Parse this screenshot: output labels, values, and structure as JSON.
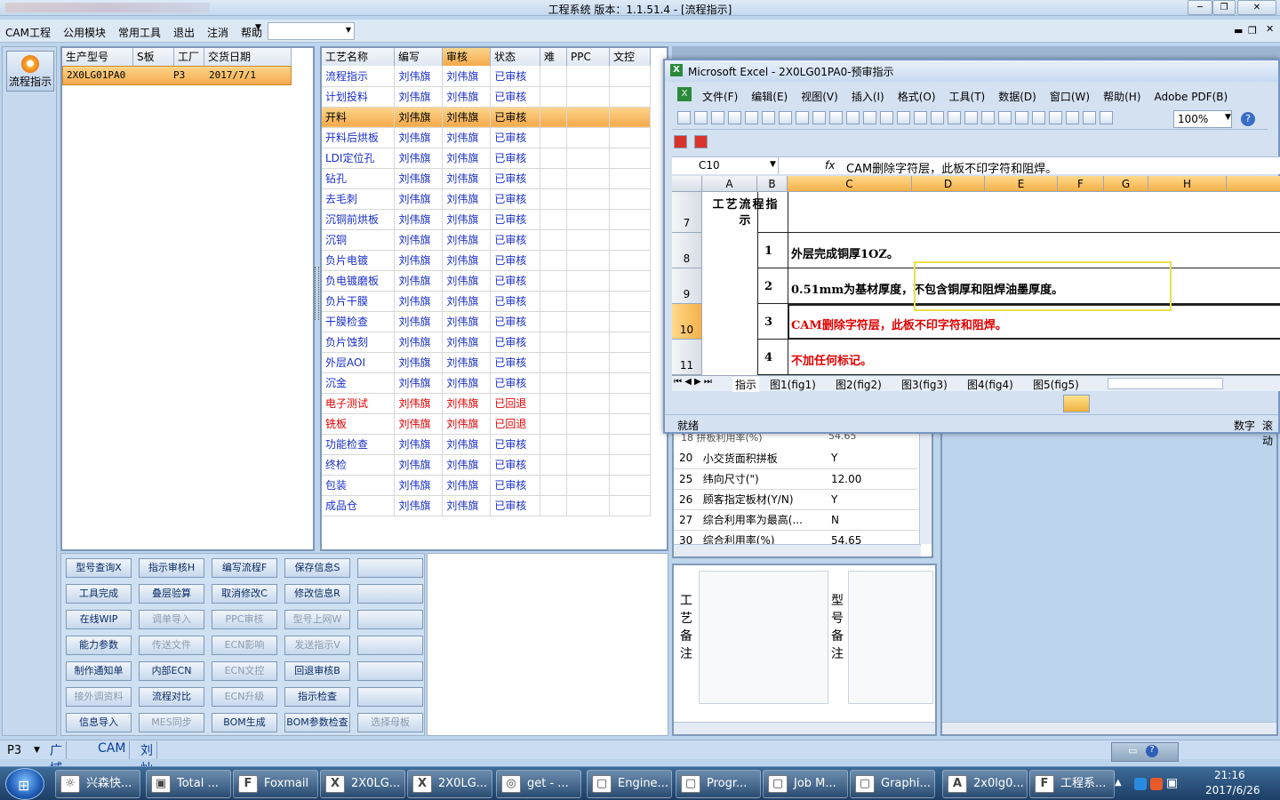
{
  "app": {
    "title": "工程系统  版本：1.1.51.4 - [流程指示]"
  },
  "menu": [
    "CAM工程",
    "公用模块",
    "常用工具",
    "退出",
    "注消",
    "帮助"
  ],
  "nav": {
    "button": "流程指示"
  },
  "orders": {
    "headers": [
      "生产型号",
      "S板",
      "工厂",
      "交货日期"
    ],
    "rows": [
      {
        "model": "2X0LG01PA0",
        "s": "",
        "factory": "P3",
        "date": "2017/7/1"
      }
    ]
  },
  "process": {
    "headers": [
      "工艺名称",
      "编写",
      "审核",
      "状态",
      "难",
      "PPC",
      "文控"
    ],
    "rows": [
      {
        "name": "流程指示",
        "writer": "刘伟旗",
        "reviewer": "刘伟旗",
        "status": "已审核",
        "color": "blue"
      },
      {
        "name": "计划投料",
        "writer": "刘伟旗",
        "reviewer": "刘伟旗",
        "status": "已审核",
        "color": "blue"
      },
      {
        "name": "开料",
        "writer": "刘伟旗",
        "reviewer": "刘伟旗",
        "status": "已审核",
        "color": "blue"
      },
      {
        "name": "开料后烘板",
        "writer": "刘伟旗",
        "reviewer": "刘伟旗",
        "status": "已审核",
        "color": "blue"
      },
      {
        "name": "LDI定位孔",
        "writer": "刘伟旗",
        "reviewer": "刘伟旗",
        "status": "已审核",
        "color": "blue"
      },
      {
        "name": "钻孔",
        "writer": "刘伟旗",
        "reviewer": "刘伟旗",
        "status": "已审核",
        "color": "blue"
      },
      {
        "name": "去毛刺",
        "writer": "刘伟旗",
        "reviewer": "刘伟旗",
        "status": "已审核",
        "color": "blue"
      },
      {
        "name": "沉铜前烘板",
        "writer": "刘伟旗",
        "reviewer": "刘伟旗",
        "status": "已审核",
        "color": "blue"
      },
      {
        "name": "沉铜",
        "writer": "刘伟旗",
        "reviewer": "刘伟旗",
        "status": "已审核",
        "color": "blue"
      },
      {
        "name": "负片电镀",
        "writer": "刘伟旗",
        "reviewer": "刘伟旗",
        "status": "已审核",
        "color": "blue"
      },
      {
        "name": "负电镀磨板",
        "writer": "刘伟旗",
        "reviewer": "刘伟旗",
        "status": "已审核",
        "color": "blue"
      },
      {
        "name": "负片干膜",
        "writer": "刘伟旗",
        "reviewer": "刘伟旗",
        "status": "已审核",
        "color": "blue"
      },
      {
        "name": "干膜检查",
        "writer": "刘伟旗",
        "reviewer": "刘伟旗",
        "status": "已审核",
        "color": "blue"
      },
      {
        "name": "负片蚀刻",
        "writer": "刘伟旗",
        "reviewer": "刘伟旗",
        "status": "已审核",
        "color": "blue"
      },
      {
        "name": "外层AOI",
        "writer": "刘伟旗",
        "reviewer": "刘伟旗",
        "status": "已审核",
        "color": "blue"
      },
      {
        "name": "沉金",
        "writer": "刘伟旗",
        "reviewer": "刘伟旗",
        "status": "已审核",
        "color": "blue"
      },
      {
        "name": "电子测试",
        "writer": "刘伟旗",
        "reviewer": "刘伟旗",
        "status": "已回退",
        "color": "red"
      },
      {
        "name": "铣板",
        "writer": "刘伟旗",
        "reviewer": "刘伟旗",
        "status": "已回退",
        "color": "red"
      },
      {
        "name": "功能检查",
        "writer": "刘伟旗",
        "reviewer": "刘伟旗",
        "status": "已审核",
        "color": "blue"
      },
      {
        "name": "终检",
        "writer": "刘伟旗",
        "reviewer": "刘伟旗",
        "status": "已审核",
        "color": "blue"
      },
      {
        "name": "包装",
        "writer": "刘伟旗",
        "reviewer": "刘伟旗",
        "status": "已审核",
        "color": "blue"
      },
      {
        "name": "成品仓",
        "writer": "刘伟旗",
        "reviewer": "刘伟旗",
        "status": "已审核",
        "color": "blue"
      }
    ]
  },
  "buttons": [
    {
      "label": "型号查询X",
      "enabled": true
    },
    {
      "label": "指示审核H",
      "enabled": true
    },
    {
      "label": "编写流程F",
      "enabled": true
    },
    {
      "label": "保存信息S",
      "enabled": true
    },
    {
      "label": "",
      "enabled": true
    },
    {
      "label": "工具完成",
      "enabled": true
    },
    {
      "label": "叠层验算",
      "enabled": true
    },
    {
      "label": "取消修改C",
      "enabled": true
    },
    {
      "label": "修改信息R",
      "enabled": true
    },
    {
      "label": "",
      "enabled": true
    },
    {
      "label": "在线WIP",
      "enabled": true
    },
    {
      "label": "调单导入",
      "enabled": false
    },
    {
      "label": "PPC审核",
      "enabled": false
    },
    {
      "label": "型号上网W",
      "enabled": false
    },
    {
      "label": "",
      "enabled": true
    },
    {
      "label": "能力参数",
      "enabled": true
    },
    {
      "label": "传送文件",
      "enabled": false
    },
    {
      "label": "ECN影响",
      "enabled": false
    },
    {
      "label": "发送指示V",
      "enabled": false
    },
    {
      "label": "",
      "enabled": true
    },
    {
      "label": "制作通知单",
      "enabled": true
    },
    {
      "label": "内部ECN",
      "enabled": true
    },
    {
      "label": "ECN文控",
      "enabled": false
    },
    {
      "label": "回退审核B",
      "enabled": true
    },
    {
      "label": "",
      "enabled": true
    },
    {
      "label": "接外调资料",
      "enabled": false
    },
    {
      "label": "流程对比",
      "enabled": true
    },
    {
      "label": "ECN升级",
      "enabled": false
    },
    {
      "label": "指示检查",
      "enabled": true
    },
    {
      "label": "",
      "enabled": true
    },
    {
      "label": "信息导入",
      "enabled": true
    },
    {
      "label": "MES同步",
      "enabled": false
    },
    {
      "label": "BOM生成",
      "enabled": true
    },
    {
      "label": "BOM参数检查",
      "enabled": true
    },
    {
      "label": "选择母板",
      "enabled": false
    }
  ],
  "props": {
    "rows": [
      {
        "num": "20",
        "name": "小交货面积拼板",
        "value": "Y"
      },
      {
        "num": "25",
        "name": "纬向尺寸(\")",
        "value": "12.00"
      },
      {
        "num": "26",
        "name": "顾客指定板材(Y/N)",
        "value": "Y"
      },
      {
        "num": "27",
        "name": "综合利用率为最高(...",
        "value": "N"
      },
      {
        "num": "30",
        "name": "综合利用率(%)",
        "value": "54.65"
      }
    ],
    "partial_top": "拼板利用率(%)",
    "partial_top_value": "54.65"
  },
  "notes": {
    "process_label": "工艺备注",
    "model_label": "型号备注"
  },
  "excel": {
    "title": "Microsoft Excel - 2X0LG01PA0-预审指示",
    "menu": [
      "文件(F)",
      "编辑(E)",
      "视图(V)",
      "插入(I)",
      "格式(O)",
      "工具(T)",
      "数据(D)",
      "窗口(W)",
      "帮助(H)",
      "Adobe PDF(B)"
    ],
    "zoom": "100%",
    "namebox": "C10",
    "formula": "CAM删除字符层，此板不印字符和阻焊。",
    "columns": [
      "A",
      "B",
      "C",
      "D",
      "E",
      "F",
      "G",
      "H"
    ],
    "header_cell": "工艺流程指示",
    "rows": [
      {
        "row": "7",
        "num": "",
        "text": "",
        "color": "black"
      },
      {
        "row": "8",
        "num": "1",
        "text": "外层完成铜厚1OZ。",
        "color": "black"
      },
      {
        "row": "9",
        "num": "2",
        "text": "0.51mm为基材厚度，不包含铜厚和阻焊油墨厚度。",
        "color": "black"
      },
      {
        "row": "10",
        "num": "3",
        "text": "CAM删除字符层，此板不印字符和阻焊。",
        "color": "red"
      },
      {
        "row": "11",
        "num": "4",
        "text": "不加任何标记。",
        "color": "red"
      }
    ],
    "tabs": [
      "指示",
      "图1(fig1)",
      "图2(fig2)",
      "图3(fig3)",
      "图4(fig4)",
      "图5(fig5)"
    ],
    "status_left": "就绪",
    "status_right": "数字",
    "status_far": "滚动"
  },
  "status": {
    "factory": "P3",
    "items": [
      "广域网",
      "CAM",
      "刘灿"
    ]
  },
  "taskbar": {
    "items": [
      "兴森快...",
      "Total ...",
      "Foxmail",
      "2X0LG...",
      "2X0LG...",
      "get - ...",
      "Engine...",
      "Progr...",
      "Job M...",
      "Graphi...",
      "2x0lg0...",
      "工程系..."
    ],
    "time": "21:16",
    "date": "2017/6/26"
  }
}
